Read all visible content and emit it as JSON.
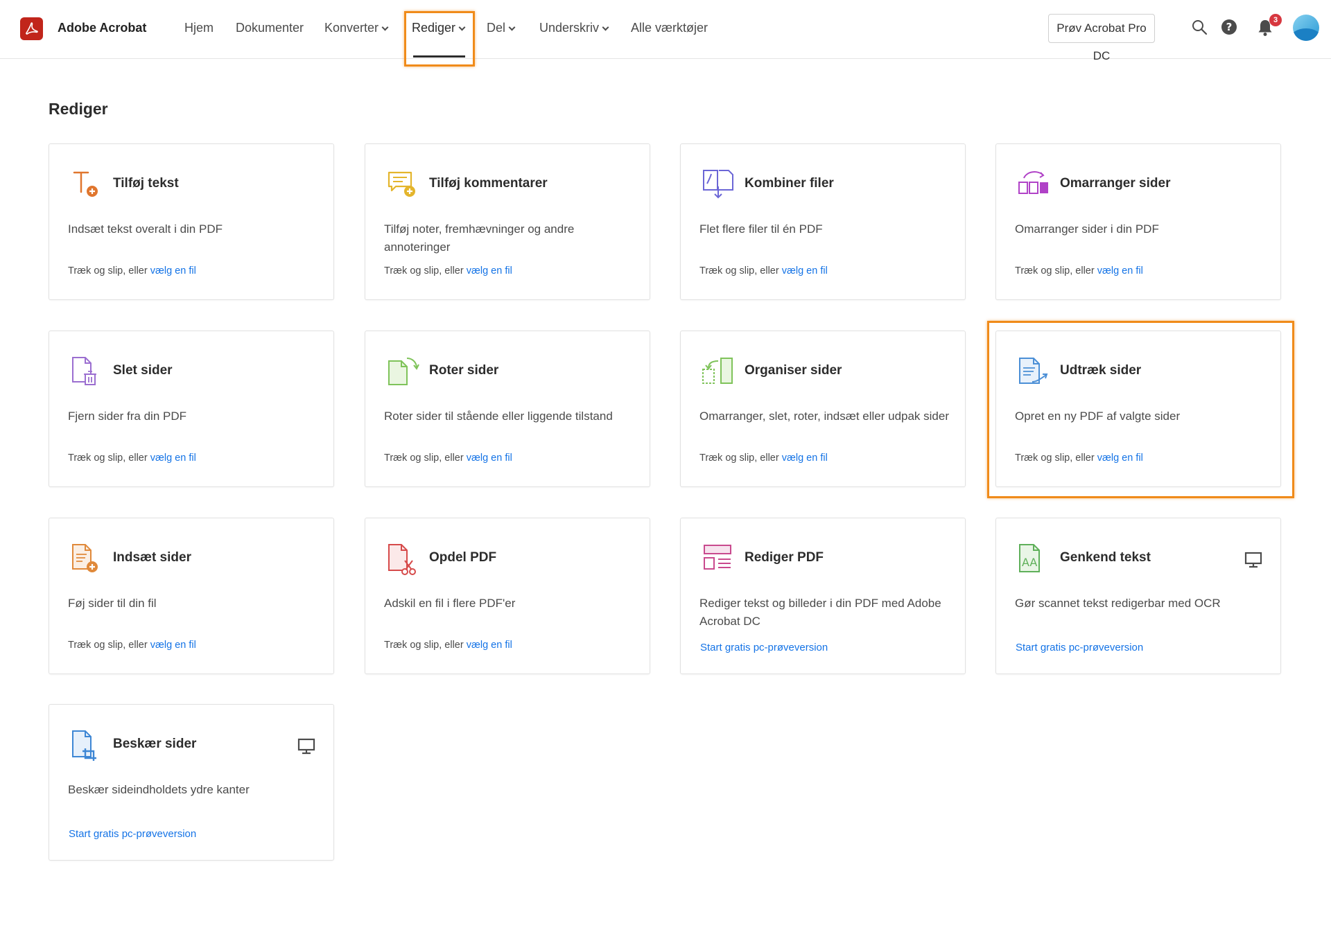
{
  "header": {
    "brand": "Adobe Acrobat",
    "nav": [
      {
        "label": "Hjem",
        "dropdown": false
      },
      {
        "label": "Dokumenter",
        "dropdown": false
      },
      {
        "label": "Konverter",
        "dropdown": true
      },
      {
        "label": "Rediger",
        "dropdown": true,
        "active": true
      },
      {
        "label": "Del",
        "dropdown": true
      },
      {
        "label": "Underskriv",
        "dropdown": true
      },
      {
        "label": "Alle værktøjer",
        "dropdown": false
      }
    ],
    "try_button": "Prøv Acrobat Pro DC",
    "notification_count": "3",
    "icons": [
      "search-icon",
      "help-icon",
      "bell-icon"
    ]
  },
  "page": {
    "title": "Rediger"
  },
  "drag_text": "Træk og slip, eller ",
  "choose_link": "vælg en fil",
  "trial_link": "Start gratis pc-prøveversion",
  "tools": [
    {
      "id": "tilfoj-tekst",
      "title": "Tilføj tekst",
      "desc": "Indsæt tekst overalt i din PDF",
      "footer": "drop",
      "icon": "add-text-icon",
      "color": "#e0762e"
    },
    {
      "id": "tilfoj-kommentarer",
      "title": "Tilføj kommentarer",
      "desc": "Tilføj noter, fremhævninger og andre annoteringer",
      "footer": "drop",
      "icon": "comment-icon",
      "color": "#e4b52c"
    },
    {
      "id": "kombiner-filer",
      "title": "Kombiner filer",
      "desc": "Flet flere filer til én PDF",
      "footer": "drop",
      "icon": "combine-icon",
      "color": "#6b66d6"
    },
    {
      "id": "omarranger-sider",
      "title": "Omarranger sider",
      "desc": "Omarranger sider i din PDF",
      "footer": "drop",
      "icon": "reorder-icon",
      "color": "#b042c7"
    },
    {
      "id": "slet-sider",
      "title": "Slet sider",
      "desc": "Fjern sider fra din PDF",
      "footer": "drop",
      "icon": "delete-pages-icon",
      "color": "#9b6ed0"
    },
    {
      "id": "roter-sider",
      "title": "Roter sider",
      "desc": "Roter sider til stående eller liggende tilstand",
      "footer": "drop",
      "icon": "rotate-icon",
      "color": "#7fc35a"
    },
    {
      "id": "organiser-sider",
      "title": "Organiser sider",
      "desc": "Omarranger, slet, roter, indsæt eller udpak sider",
      "footer": "drop",
      "icon": "organize-icon",
      "color": "#7fc35a"
    },
    {
      "id": "udtraek-sider",
      "title": "Udtræk sider",
      "desc": "Opret en ny PDF af valgte sider",
      "footer": "drop",
      "icon": "extract-icon",
      "color": "#4b8fd6"
    },
    {
      "id": "indsaet-sider",
      "title": "Indsæt sider",
      "desc": "Føj sider til din fil",
      "footer": "drop",
      "icon": "insert-pages-icon",
      "color": "#e0893a"
    },
    {
      "id": "opdel-pdf",
      "title": "Opdel PDF",
      "desc": "Adskil en fil i flere PDF'er",
      "footer": "drop",
      "icon": "split-icon",
      "color": "#d64a4a"
    },
    {
      "id": "rediger-pdf",
      "title": "Rediger PDF",
      "desc": "Rediger tekst og billeder i din PDF med Adobe Acrobat DC",
      "footer": "trial",
      "icon": "edit-pdf-icon",
      "color": "#c94a8e"
    },
    {
      "id": "genkend-tekst",
      "title": "Genkend tekst",
      "desc": "Gør scannet tekst redigerbar med OCR",
      "footer": "trial",
      "icon": "ocr-icon",
      "color": "#5fb05a",
      "desktop": true
    },
    {
      "id": "beskaer-sider",
      "title": "Beskær sider",
      "desc": "Beskær sideindholdets ydre kanter",
      "footer": "trial",
      "icon": "crop-icon",
      "color": "#3d86d4",
      "desktop": true
    }
  ]
}
